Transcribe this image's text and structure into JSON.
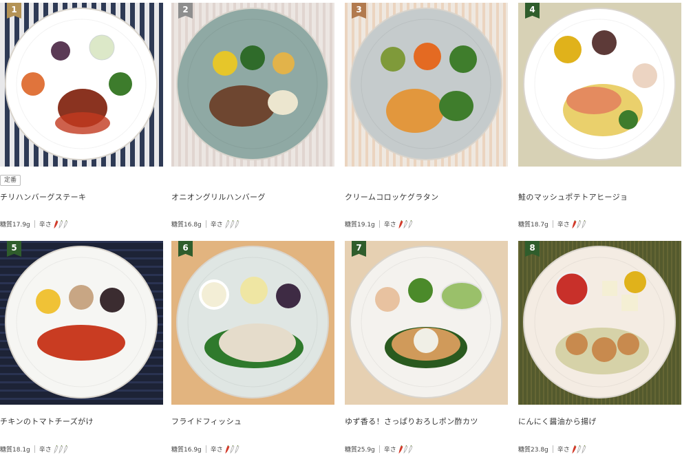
{
  "products": [
    {
      "rank": "1",
      "name": "チリハンバーグステーキ",
      "carb": "糖質17.9g",
      "spice_label": "辛さ",
      "badge": "定番",
      "rank_color": "gold",
      "peppers": [
        1,
        0,
        0
      ],
      "bg": "#2e3a55",
      "bg2": "#e8e8ea",
      "plate": "#ffffff"
    },
    {
      "rank": "2",
      "name": "オニオングリルハンバーグ",
      "carb": "糖質16.8g",
      "spice_label": "辛さ",
      "rank_color": "silver",
      "peppers": [
        0,
        0,
        0
      ],
      "bg": "#ece6e2",
      "bg2": "#d9c9c4",
      "plate": "#8fa9a4"
    },
    {
      "rank": "3",
      "name": "クリームコロッケグラタン",
      "carb": "糖質19.1g",
      "spice_label": "辛さ",
      "rank_color": "bronze",
      "peppers": [
        1,
        0,
        0
      ],
      "bg": "#efe8e0",
      "bg2": "#e7c7a8",
      "plate": "#c5cbcc"
    },
    {
      "rank": "4",
      "name": "鮭のマッシュポテトアヒージョ",
      "carb": "糖質18.7g",
      "spice_label": "辛さ",
      "rank_color": "green",
      "peppers": [
        1,
        0,
        0
      ],
      "bg": "#d7d1b5",
      "bg2": "#cfc8a9",
      "plate": "#ffffff"
    },
    {
      "rank": "5",
      "name": "チキンのトマトチーズがけ",
      "carb": "糖質18.1g",
      "spice_label": "辛さ",
      "rank_color": "green",
      "peppers": [
        0,
        0,
        0
      ],
      "bg": "#1d2336",
      "bg2": "#2a3352",
      "plate": "#f6f6f3"
    },
    {
      "rank": "6",
      "name": "フライドフィッシュ",
      "carb": "糖質16.9g",
      "spice_label": "辛さ",
      "rank_color": "green",
      "peppers": [
        1,
        0,
        0
      ],
      "bg": "#e2b47f",
      "bg2": "#d8a673",
      "plate": "#dfe6e3"
    },
    {
      "rank": "7",
      "name": "ゆず香る！さっぱりおろしポン酢カツ",
      "carb": "糖質25.9g",
      "spice_label": "辛さ",
      "rank_color": "green",
      "peppers": [
        1,
        0,
        0
      ],
      "bg": "#e6d0b2",
      "bg2": "#d9c0a0",
      "plate": "#f4f2ee"
    },
    {
      "rank": "8",
      "name": "にんにく醤油から揚げ",
      "carb": "糖質23.8g",
      "spice_label": "辛さ",
      "rank_color": "green",
      "peppers": [
        1,
        0,
        0
      ],
      "bg": "#545a2d",
      "bg2": "#6c6b38",
      "plate": "#f4ece3"
    }
  ]
}
